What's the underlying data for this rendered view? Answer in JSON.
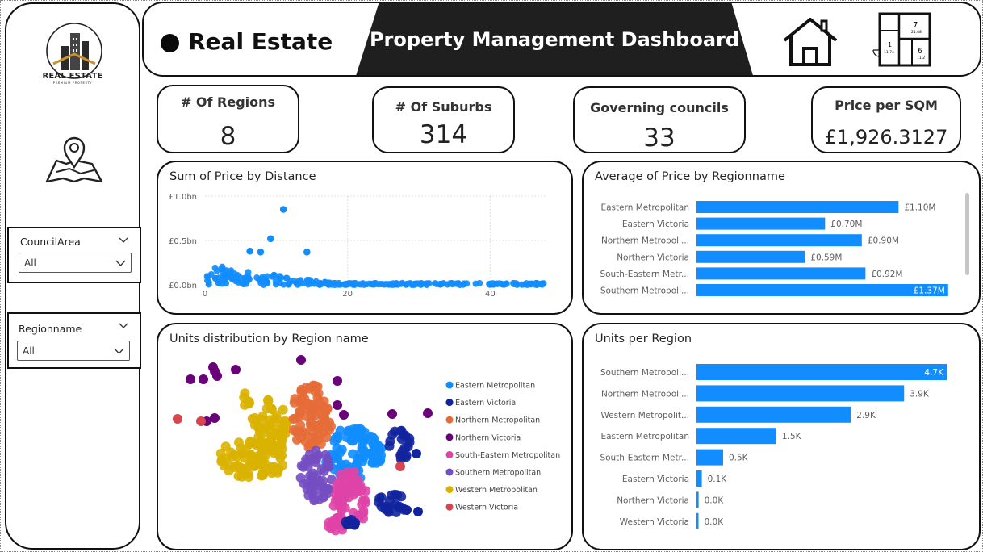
{
  "sidebar": {
    "logo": {
      "name": "REAL ESTATE",
      "tagline": "PREMIUM PROPERTY",
      "icon": "building-logo-icon"
    },
    "map_icon": "map-pin-icon",
    "slicers": [
      {
        "title": "CouncilArea",
        "value": "All"
      },
      {
        "title": "Regionname",
        "value": "All"
      }
    ]
  },
  "header": {
    "brand": "Real Estate",
    "title": "Property Management Dashboard",
    "floor_plan_labels": {
      "room1": "1",
      "room1_area": "11.74",
      "room7": "7",
      "room7_area": "21.48",
      "room6": "6",
      "room6_area": "11.2"
    }
  },
  "kpis": [
    {
      "label": "# Of Regions",
      "value": "8"
    },
    {
      "label": "# Of Suburbs",
      "value": "314"
    },
    {
      "label": "Governing councils",
      "value": "33"
    },
    {
      "label": "Price per SQM",
      "value": "£1,926.3127"
    }
  ],
  "colors": {
    "bar": "#118DFF",
    "regions": {
      "Eastern Metropolitan": "#118DFF",
      "Eastern Victoria": "#12239E",
      "Northern Metropolitan": "#E66C37",
      "Northern Victoria": "#6B007B",
      "South-Eastern Metropolitan": "#E044A7",
      "Southern Metropolitan": "#744EC2",
      "Western Metropolitan": "#D9B300",
      "Western Victoria": "#D64550"
    }
  },
  "charts": {
    "scatter": {
      "title": "Sum of Price by Distance",
      "chart_data": {
        "type": "scatter",
        "xlim": [
          0,
          48
        ],
        "ylim": [
          0,
          1.0
        ],
        "xticks": [
          "0",
          "20",
          "40"
        ],
        "yticks": [
          "£0.0bn",
          "£0.5bn",
          "£1.0bn"
        ],
        "outliers": [
          [
            11,
            0.85
          ],
          [
            9.2,
            0.52
          ],
          [
            14.3,
            0.37
          ],
          [
            6.3,
            0.38
          ],
          [
            7.8,
            0.37
          ]
        ]
      }
    },
    "avg_price": {
      "title": "Average of Price by Regionname",
      "chart_data": {
        "type": "bar",
        "orientation": "horizontal",
        "categories": [
          "Eastern Metropolitan",
          "Eastern Victoria",
          "Northern Metropoli...",
          "Northern Victoria",
          "South-Eastern Metr...",
          "Southern Metropoli..."
        ],
        "values": [
          1.1,
          0.7,
          0.9,
          0.59,
          0.92,
          1.37
        ],
        "labels": [
          "£1.10M",
          "£0.70M",
          "£0.90M",
          "£0.59M",
          "£0.92M",
          "£1.37M"
        ],
        "xlim": [
          0,
          1.45
        ]
      }
    },
    "map": {
      "title": "Units distribution by Region name",
      "legend": [
        "Eastern Metropolitan",
        "Eastern Victoria",
        "Northern Metropolitan",
        "Northern Victoria",
        "South-Eastern Metropolitan",
        "Southern Metropolitan",
        "Western Metropolitan",
        "Western Victoria"
      ]
    },
    "units": {
      "title": "Units per Region",
      "chart_data": {
        "type": "bar",
        "orientation": "horizontal",
        "categories": [
          "Southern Metropoli...",
          "Northern Metropoli...",
          "Western Metropolit...",
          "Eastern Metropolitan",
          "South-Eastern Metr...",
          "Eastern Victoria",
          "Northern Victoria",
          "Western Victoria"
        ],
        "values": [
          4700,
          3900,
          2900,
          1500,
          500,
          100,
          40,
          30
        ],
        "labels": [
          "4.7K",
          "3.9K",
          "2.9K",
          "1.5K",
          "0.5K",
          "0.1K",
          "0.0K",
          "0.0K"
        ],
        "xlim": [
          0,
          4700
        ]
      }
    }
  }
}
